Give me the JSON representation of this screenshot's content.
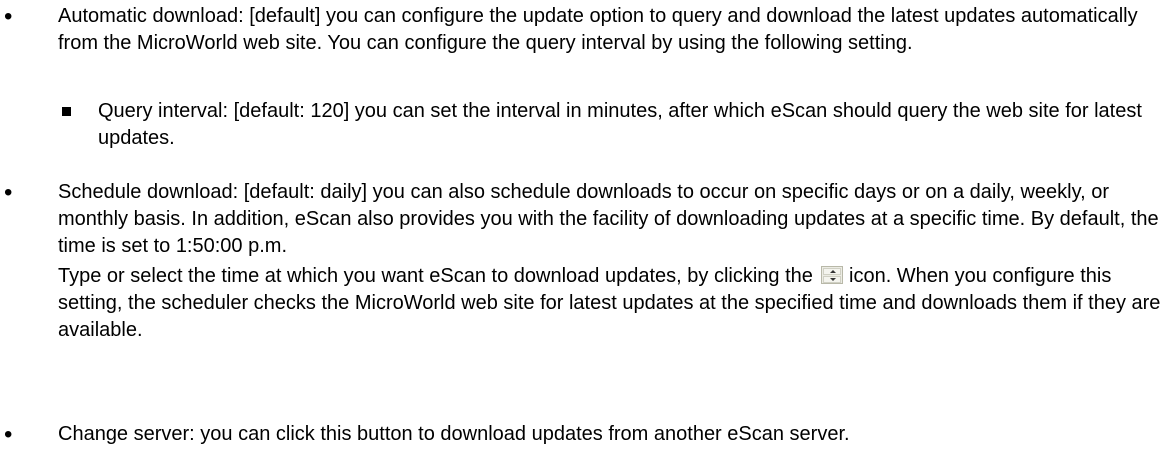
{
  "items": [
    {
      "bullet": "•",
      "text": "Automatic download: [default] you can configure the update option to query and download the latest updates automatically from the MicroWorld web site. You can configure the query interval by using the following setting."
    },
    {
      "bullet": "•",
      "text": "Schedule download: [default: daily] you can also schedule downloads to occur on specific days or on a daily, weekly, or monthly basis. In addition, eScan also provides you with the facility of downloading updates at a specific time. By default, the time is set to 1:50:00 p.m.",
      "text2_before_icon": "Type or select the time at which you want eScan to download updates, by clicking the",
      "text2_after_icon": "icon. When you configure this setting, the scheduler checks the MicroWorld web site for latest updates at the specified time and downloads them if they are available.",
      "icon": "spin-button-icon"
    },
    {
      "bullet": "•",
      "text": "Change server: you can click this button to download updates from another eScan server."
    }
  ],
  "sub_items": [
    {
      "bullet": "■",
      "text": "Query interval: [default: 120] you can set the interval in minutes, after which eScan should query the web site for latest updates."
    }
  ]
}
